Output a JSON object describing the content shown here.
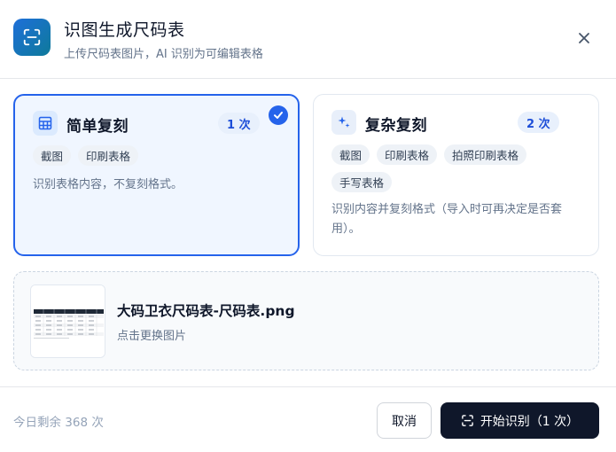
{
  "dialog": {
    "title": "识图生成尺码表",
    "subtitle": "上传尺码表图片，AI 识别为可编辑表格",
    "app_icon": "scan-icon",
    "close_icon": "close-icon"
  },
  "options": [
    {
      "title": "简单复刻",
      "icon": "table-icon",
      "count": "1 次",
      "selected": true,
      "tags": [
        "截图",
        "印刷表格"
      ],
      "description": "识别表格内容，不复刻格式。"
    },
    {
      "title": "复杂复刻",
      "icon": "sparkle-icon",
      "count": "2 次",
      "selected": false,
      "tags": [
        "截图",
        "印刷表格",
        "拍照印刷表格",
        "手写表格"
      ],
      "description": "识别内容并复刻格式（导入时可再决定是否套用）。"
    }
  ],
  "upload": {
    "file_name": "大码卫衣尺码表-尺码表.png",
    "hint": "点击更换图片"
  },
  "footer": {
    "remaining": "今日剩余 368 次",
    "cancel_label": "取消",
    "start_label": "开始识别（1 次）"
  },
  "colors": {
    "accent": "#2563eb",
    "primary_button": "#0f172a",
    "selected_bg": "#f0f6ff"
  }
}
